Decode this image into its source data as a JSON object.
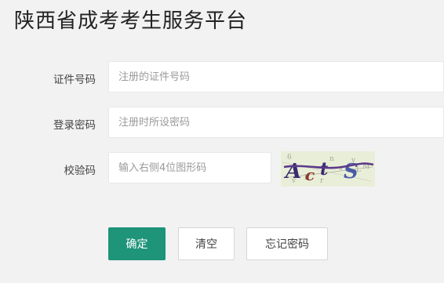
{
  "header": {
    "title": "陕西省成考考生服务平台"
  },
  "form": {
    "id_number": {
      "label": "证件号码",
      "value": "",
      "placeholder": "注册的证件号码"
    },
    "password": {
      "label": "登录密码",
      "value": "",
      "placeholder": "注册时所设密码"
    },
    "captcha": {
      "label": "校验码",
      "value": "",
      "placeholder": "输入右侧4位图形码",
      "image_text": "ActS"
    }
  },
  "buttons": {
    "confirm": "确定",
    "clear": "清空",
    "forgot_password": "忘记密码"
  },
  "colors": {
    "primary": "#1e9479",
    "background": "#f2f2f2"
  }
}
